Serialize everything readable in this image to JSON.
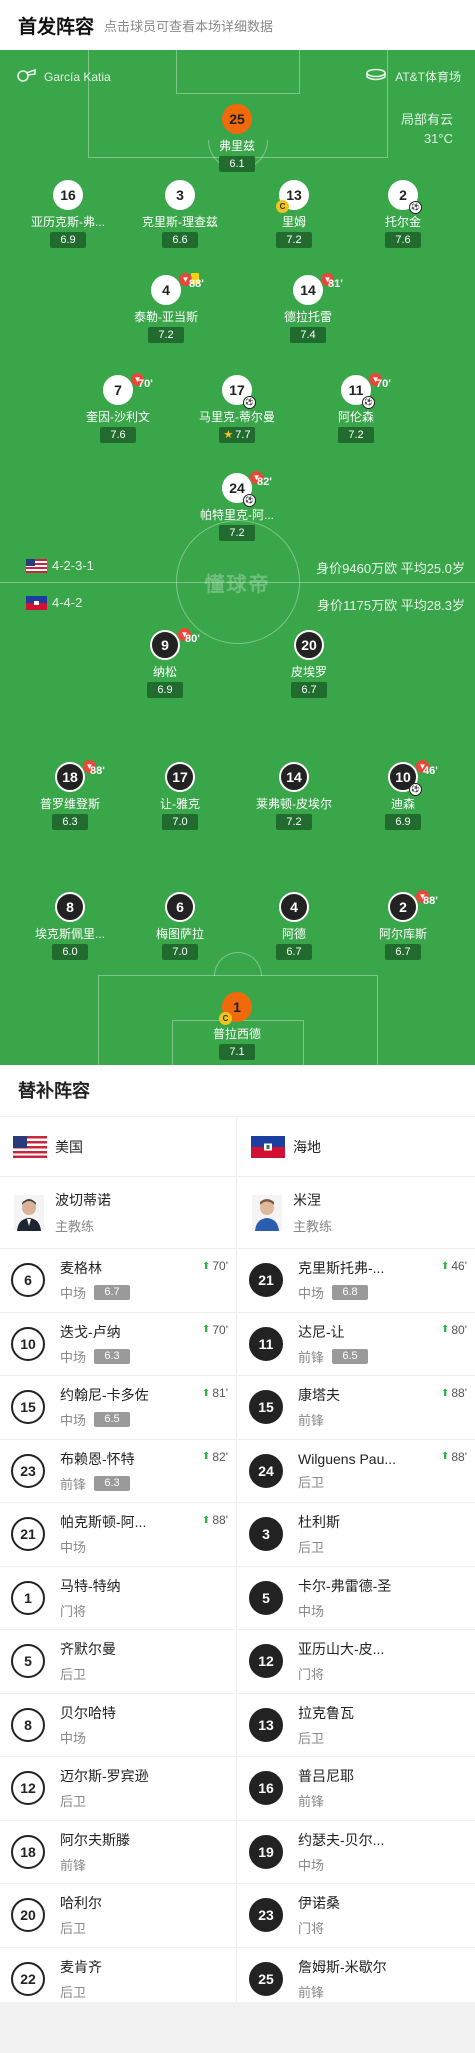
{
  "header": {
    "title": "首发阵容",
    "hint": "点击球员可查看本场详细数据"
  },
  "match": {
    "referee": "García Katia",
    "venue": "AT&T体育场",
    "weather": "局部有云",
    "temperature": "31°C",
    "watermark": "懂球帝"
  },
  "home": {
    "formation": "4-2-3-1",
    "value": "身价9460万欧 平均25.0岁",
    "players": [
      {
        "num": "25",
        "name": "弗里兹",
        "rating": "6.1",
        "gk": true
      },
      {
        "num": "16",
        "name": "亚历克斯-弗...",
        "rating": "6.9"
      },
      {
        "num": "3",
        "name": "克里斯-理查兹",
        "rating": "6.6"
      },
      {
        "num": "13",
        "name": "里姆",
        "rating": "7.2",
        "captain": "C"
      },
      {
        "num": "2",
        "name": "托尔金",
        "rating": "7.6"
      },
      {
        "num": "4",
        "name": "泰勒-亚当斯",
        "rating": "7.2",
        "sub_min": "88'"
      },
      {
        "num": "14",
        "name": "德拉托雷",
        "rating": "7.4",
        "sub_min": "81'"
      },
      {
        "num": "7",
        "name": "奎因-沙利文",
        "rating": "7.6",
        "sub_min": "70'"
      },
      {
        "num": "17",
        "name": "马里克-蒂尔曼",
        "rating": "7.7",
        "star": true
      },
      {
        "num": "11",
        "name": "阿伦森",
        "rating": "7.2",
        "sub_min": "70'"
      },
      {
        "num": "24",
        "name": "帕特里克-阿...",
        "rating": "7.2",
        "sub_min": "82'"
      }
    ]
  },
  "away": {
    "formation": "4-4-2",
    "value": "身价1175万欧 平均28.3岁",
    "players": [
      {
        "num": "9",
        "name": "纳松",
        "rating": "6.9",
        "sub_min": "80'"
      },
      {
        "num": "20",
        "name": "皮埃罗",
        "rating": "6.7"
      },
      {
        "num": "18",
        "name": "普罗维登斯",
        "rating": "6.3",
        "sub_min": "88'"
      },
      {
        "num": "17",
        "name": "让-雅克",
        "rating": "7.0"
      },
      {
        "num": "14",
        "name": "莱弗顿-皮埃尔",
        "rating": "7.2"
      },
      {
        "num": "10",
        "name": "迪森",
        "rating": "6.9",
        "sub_min": "46'"
      },
      {
        "num": "8",
        "name": "埃克斯佩里...",
        "rating": "6.0"
      },
      {
        "num": "6",
        "name": "梅图萨拉",
        "rating": "7.0"
      },
      {
        "num": "4",
        "name": "阿德",
        "rating": "6.7"
      },
      {
        "num": "2",
        "name": "阿尔库斯",
        "rating": "6.7",
        "sub_min": "88'"
      },
      {
        "num": "1",
        "name": "普拉西德",
        "rating": "7.1",
        "gk": true,
        "captain": "C"
      }
    ]
  },
  "subs_section": {
    "title": "替补阵容",
    "home_team": "美国",
    "away_team": "海地",
    "home_coach": {
      "name": "波切蒂诺",
      "role": "主教练"
    },
    "away_coach": {
      "name": "米涅",
      "role": "主教练"
    },
    "home_subs": [
      {
        "num": "6",
        "name": "麦格林",
        "pos": "中场",
        "rating": "6.7",
        "in": "70'"
      },
      {
        "num": "10",
        "name": "迭戈-卢纳",
        "pos": "中场",
        "rating": "6.3",
        "in": "70'"
      },
      {
        "num": "15",
        "name": "约翰尼-卡多佐",
        "pos": "中场",
        "rating": "6.5",
        "in": "81'"
      },
      {
        "num": "23",
        "name": "布赖恩-怀特",
        "pos": "前锋",
        "rating": "6.3",
        "in": "82'"
      },
      {
        "num": "21",
        "name": "帕克斯顿-阿...",
        "pos": "中场",
        "rating": "",
        "in": "88'"
      },
      {
        "num": "1",
        "name": "马特-特纳",
        "pos": "门将",
        "rating": "",
        "in": ""
      },
      {
        "num": "5",
        "name": "齐默尔曼",
        "pos": "后卫",
        "rating": "",
        "in": ""
      },
      {
        "num": "8",
        "name": "贝尔哈特",
        "pos": "中场",
        "rating": "",
        "in": ""
      },
      {
        "num": "12",
        "name": "迈尔斯-罗宾逊",
        "pos": "后卫",
        "rating": "",
        "in": ""
      },
      {
        "num": "18",
        "name": "阿尔夫斯滕",
        "pos": "前锋",
        "rating": "",
        "in": ""
      },
      {
        "num": "20",
        "name": "哈利尔",
        "pos": "后卫",
        "rating": "",
        "in": ""
      },
      {
        "num": "22",
        "name": "麦肯齐",
        "pos": "后卫",
        "rating": "",
        "in": ""
      }
    ],
    "away_subs": [
      {
        "num": "21",
        "name": "克里斯托弗-...",
        "pos": "中场",
        "rating": "6.8",
        "in": "46'"
      },
      {
        "num": "11",
        "name": "达尼-让",
        "pos": "前锋",
        "rating": "6.5",
        "in": "80'"
      },
      {
        "num": "15",
        "name": "康塔夫",
        "pos": "前锋",
        "rating": "",
        "in": "88'"
      },
      {
        "num": "24",
        "name": "Wilguens Pau...",
        "pos": "后卫",
        "rating": "",
        "in": "88'"
      },
      {
        "num": "3",
        "name": "杜利斯",
        "pos": "后卫",
        "rating": "",
        "in": ""
      },
      {
        "num": "5",
        "name": "卡尔-弗雷德-圣",
        "pos": "中场",
        "rating": "",
        "in": ""
      },
      {
        "num": "12",
        "name": "亚历山大-皮...",
        "pos": "门将",
        "rating": "",
        "in": ""
      },
      {
        "num": "13",
        "name": "拉克鲁瓦",
        "pos": "后卫",
        "rating": "",
        "in": ""
      },
      {
        "num": "16",
        "name": "普吕尼耶",
        "pos": "前锋",
        "rating": "",
        "in": ""
      },
      {
        "num": "19",
        "name": "约瑟夫-贝尔...",
        "pos": "中场",
        "rating": "",
        "in": ""
      },
      {
        "num": "23",
        "name": "伊诺桑",
        "pos": "门将",
        "rating": "",
        "in": ""
      },
      {
        "num": "25",
        "name": "詹姆斯-米歇尔",
        "pos": "前锋",
        "rating": "",
        "in": ""
      }
    ]
  },
  "colors": {
    "pitch": "#3aa64a",
    "keeper": "#f06a0c",
    "rating_bg": "#216b2f",
    "sub_in": "#2bb04a",
    "sub_out": "#e8473a"
  },
  "icons": {
    "referee": "whistle-icon",
    "venue": "stadium-icon",
    "sub_in": "arrow-up-icon",
    "sub_out": "arrow-down-icon",
    "captain": "captain-badge-icon",
    "goal": "soccer-ball-icon"
  }
}
